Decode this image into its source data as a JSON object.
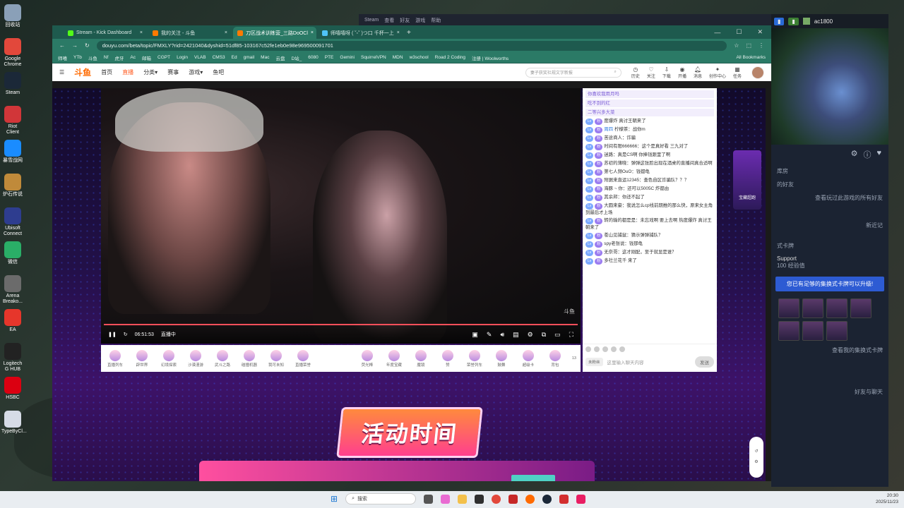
{
  "desktop": {
    "icons": [
      {
        "label": "回收站",
        "color": "#8aa0b8"
      },
      {
        "label": "Google Chrome",
        "color": "#e2483b"
      },
      {
        "label": "Steam",
        "color": "#1b2838"
      },
      {
        "label": "Riot Client",
        "color": "#d13639"
      },
      {
        "label": "暴雪战网",
        "color": "#1a8cff"
      },
      {
        "label": "炉石传说",
        "color": "#c08a3a"
      },
      {
        "label": "Ubisoft Connect",
        "color": "#2e3d8f"
      },
      {
        "label": "微信",
        "color": "#2aae67"
      },
      {
        "label": "Arena Breako...",
        "color": "#6b6b6b"
      },
      {
        "label": "EA",
        "color": "#e6362b"
      },
      {
        "label": "Logitech G HUB",
        "color": "#222222"
      },
      {
        "label": "HSBC",
        "color": "#db0011"
      },
      {
        "label": "TypeByCl...",
        "color": "#d6dbe6"
      }
    ]
  },
  "steam_bar": {
    "items": [
      "Steam",
      "查看",
      "好友",
      "游戏",
      "帮助"
    ]
  },
  "browser": {
    "tabs": [
      {
        "title": "Stream - Kick Dashboard",
        "fav_color": "#53fc18",
        "active": false
      },
      {
        "title": "我的关注 - 斗鱼",
        "fav_color": "#ff7a00",
        "active": false
      },
      {
        "title": "刀区战术训练营_三路DoOCl",
        "fav_color": "#ff7a00",
        "active": true
      },
      {
        "title": "师嘻嘻呀 ( ˘ᵕ˘ )つ口 千杯一上",
        "fav_color": "#4fc3f7",
        "active": false
      }
    ],
    "new_tab": "+",
    "window_controls": [
      "—",
      "☐",
      "✕"
    ],
    "url": "douyu.com/beta/topic/FMXLY?rid=2421040&dyshid=51df85-103167c52fe1eb0e98e969500091701",
    "bookmarks": [
      "师嘻",
      "YTb",
      "斗鱼",
      "Nf",
      "虎牙",
      "Ac",
      "邮箱",
      "CGPT",
      "Login",
      "VLAB",
      "CMS3",
      "Ed",
      "gmail",
      "Mac",
      "云盘",
      "D站_",
      "6080",
      "PTE",
      "Gemini",
      "SquirrelVPN",
      "MDN",
      "w3school",
      "Road 2 Coding",
      "注册 | Woolworths"
    ],
    "all_bookmarks": "All Bookmarks"
  },
  "douyu": {
    "logo": "斗鱼",
    "nav": [
      {
        "label": "首页",
        "on": false
      },
      {
        "label": "直播",
        "on": true
      },
      {
        "label": "分类▾",
        "on": false
      },
      {
        "label": "赛事",
        "on": false
      },
      {
        "label": "游戏▾",
        "on": false
      },
      {
        "label": "鱼吧",
        "on": false
      }
    ],
    "search_placeholder": "妻子获奖社规文字新报",
    "header_icons": [
      "历史",
      "关注",
      "下载",
      "开播",
      "消息",
      "创作中心",
      "任务"
    ]
  },
  "player": {
    "time": "06:51:53",
    "live_label": "直播中",
    "room_id": "2421040",
    "watermark": "斗鱼",
    "gifts_left": [
      "直播列车",
      "辟世界",
      "幻境探索",
      "沙漠漫游",
      "武斗之路",
      "碰撞机器",
      "我可未知",
      "直播荣誉"
    ],
    "gifts_right": [
      "荧光棒",
      "年度宝藏",
      "魔镜",
      "赞",
      "荣誉列车",
      "鼓舞",
      "超级卡",
      "背包"
    ],
    "backpack_count": "13"
  },
  "chat": {
    "pinned": [
      "你喜欢我用月吗",
      "吃不到的红",
      "二等兴多大菜"
    ],
    "messages": [
      {
        "name": "",
        "text": "度爆炸 真讨王朝来了"
      },
      {
        "name": "周四",
        "text": "柠檬茶：战你m"
      },
      {
        "name": "",
        "text": "苦途商人：诈骗"
      },
      {
        "name": "",
        "text": "时间有限666666：这个是真好看 三九对了"
      },
      {
        "name": "",
        "text": "迷路：真是CS啊 你捧钱跟里了啊"
      },
      {
        "name": "",
        "text": "苏初的薄晓：弹弹这张脸出现在酒桌的直播间真合适啊"
      },
      {
        "name": "",
        "text": "第七人频OuO：钱都龟"
      },
      {
        "name": "",
        "text": "附据来直运12345：查色自区诈骗队？？？"
      },
      {
        "name": "",
        "text": "海豚 ~ 你：还可以5005C  炸都由"
      },
      {
        "name": "",
        "text": "其余邦：你还不起了"
      },
      {
        "name": "",
        "text": "大圆来豪：我说怎么cp线前期推的那么快，原来女主角到最后才上场"
      },
      {
        "name": "",
        "text": "转的输的都是是：未忘戏啊 要上去啊 热度爆炸 真讨王朝来了"
      },
      {
        "name": "",
        "text": "苍山见捕鼠：猜示弹弹捕队？"
      },
      {
        "name": "",
        "text": "spy老张说：钱那龟"
      },
      {
        "name": "",
        "text": "无奈哥：这才刚配，至于就显是谁？"
      },
      {
        "name": "",
        "text": "多社兰花千 来了"
      }
    ],
    "input_placeholder": "这里输入聊天内容",
    "send_label": "发送",
    "fans_label": "未粉丝"
  },
  "side_ad": "宝藏超跑",
  "activity_banner": "活动时间",
  "steam": {
    "user": "ac1800",
    "friends_title": "的好友",
    "friend_name": "Support",
    "friend_status": "100 经验值",
    "banner": "您已有足够的集换式卡牌可以升级!",
    "bottom_link": "查看我的集换式卡牌",
    "chat_label": "好友与聊天",
    "misc": [
      "库房",
      "查看玩过此游戏的所有好友",
      "新近记",
      "式卡牌"
    ]
  },
  "taskbar": {
    "search": "搜索",
    "time": "20:30",
    "date": "2025/11/23"
  }
}
